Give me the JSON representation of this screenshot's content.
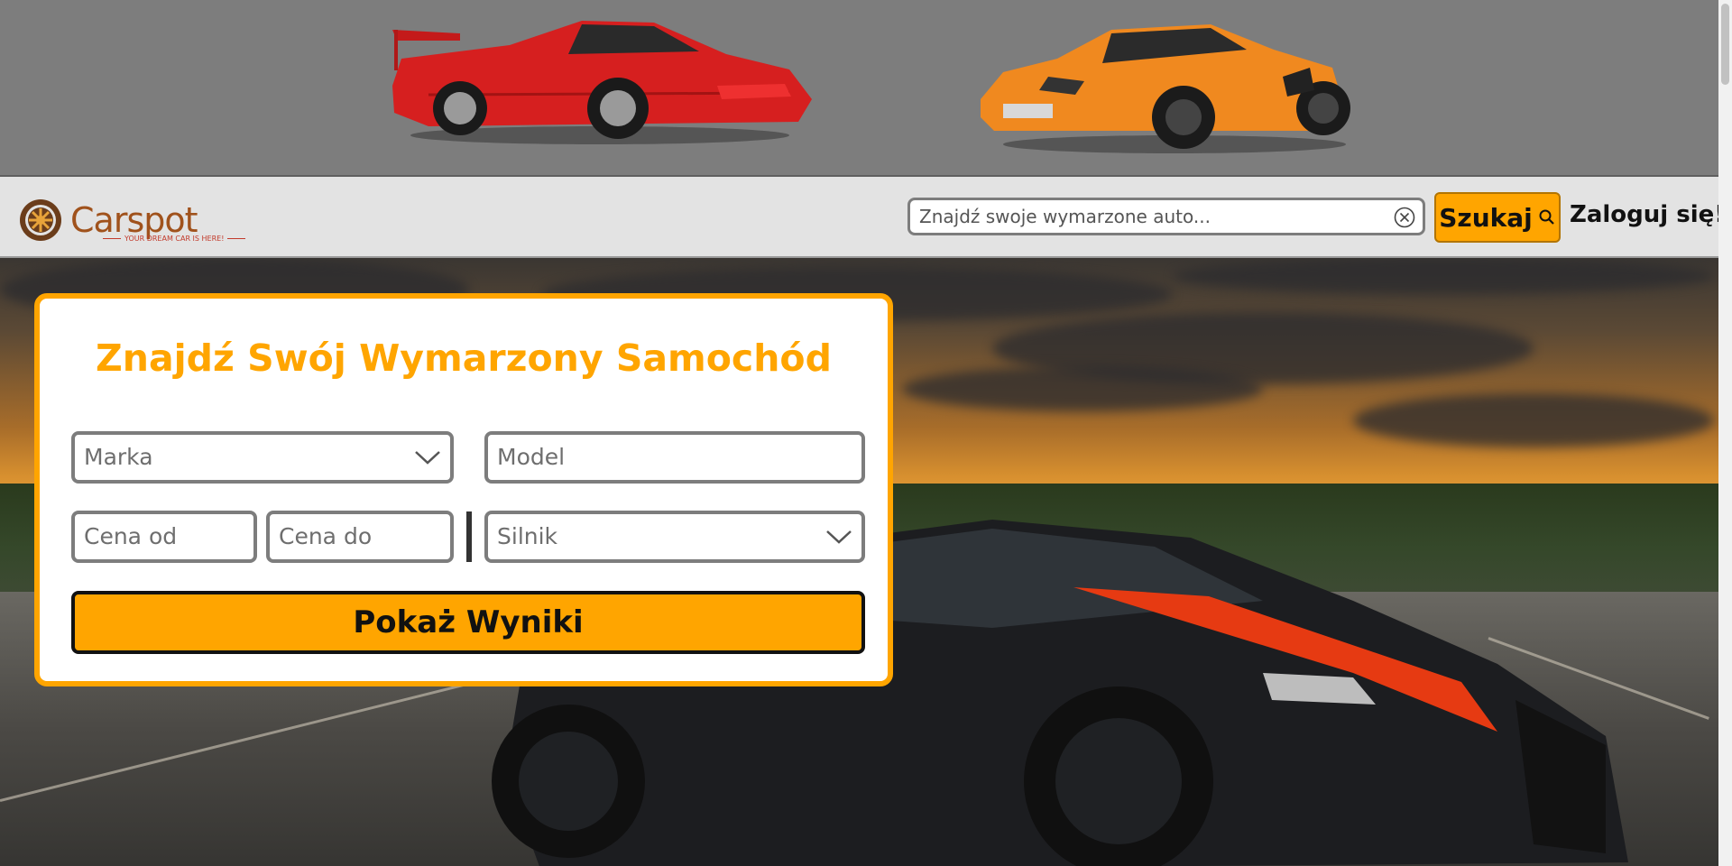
{
  "brand": {
    "name": "Carspot",
    "tagline": "YOUR DREAM CAR IS HERE!"
  },
  "navbar": {
    "search_placeholder": "Znajdź swoje wymarzone auto...",
    "search_button_label": "Szukaj",
    "login_label": "Zaloguj się!"
  },
  "search_card": {
    "title": "Znajdź Swój Wymarzony Samochód",
    "make_label": "Marka",
    "model_label": "Model",
    "price_from_label": "Cena od",
    "price_to_label": "Cena do",
    "engine_label": "Silnik",
    "submit_label": "Pokaż Wyniki"
  },
  "colors": {
    "accent": "#ffa500",
    "logo": "#a0521c",
    "banner_bg": "#7d7d7d",
    "navbar_bg": "#e3e3e3"
  },
  "icons": {
    "logo": "wheel-icon",
    "clear": "clear-circle-x-icon",
    "search": "search-icon",
    "dropdown": "chevron-down-icon"
  }
}
